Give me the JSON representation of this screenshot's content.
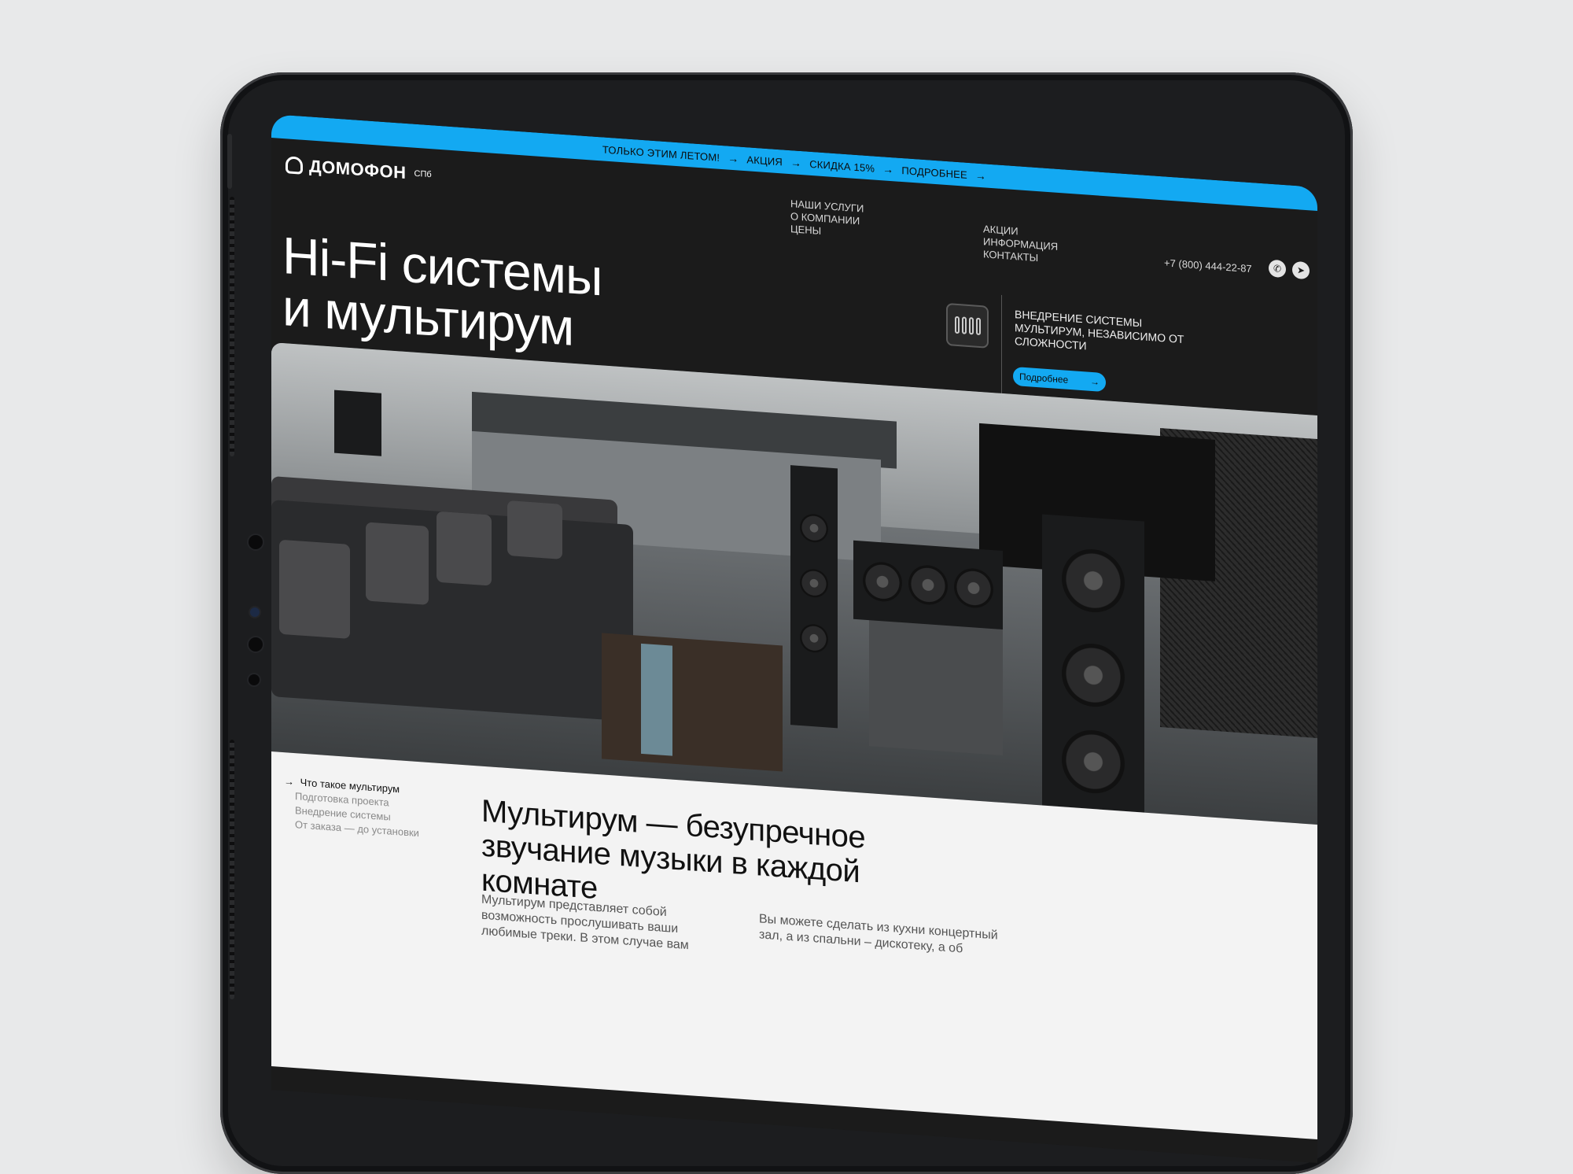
{
  "promo": {
    "text1": "ТОЛЬКО ЭТИМ ЛЕТОМ!",
    "text2": "АКЦИЯ",
    "text3": "СКИДКА 15%",
    "text4": "ПОДРОБНЕЕ",
    "arrow": "→"
  },
  "logo": {
    "name": "ДОМОФОН",
    "suffix": "СПб"
  },
  "nav": {
    "col1": [
      "НАШИ УСЛУГИ",
      "О КОМПАНИИ",
      "ЦЕНЫ"
    ],
    "col2": [
      "АКЦИИ",
      "ИНФОРМАЦИЯ",
      "КОНТАКТЫ"
    ]
  },
  "phone": "+7 (800) 444-22-87",
  "social": {
    "whatsapp": "whatsapp-icon",
    "telegram": "telegram-icon"
  },
  "hero": {
    "title_line1": "Hi-Fi системы",
    "title_line2": "и мультирум",
    "description": "ВНЕДРЕНИЕ СИСТЕМЫ МУЛЬТИРУМ, НЕЗАВИСИМО ОТ СЛОЖНОСТИ",
    "button": "Подробнее",
    "button_arrow": "→"
  },
  "toc": {
    "active": "Что такое мультирум",
    "active_arrow": "→",
    "items": [
      "Подготовка проекта",
      "Внедрение системы",
      "От заказа — до установки"
    ]
  },
  "content": {
    "title": "Мультирум — безупречное звучание музыки в каждой комнате",
    "para1": "Мультирум представляет собой возможность прослушивать ваши любимые треки. В этом случае вам",
    "para2": "Вы можете сделать из кухни концертный зал, а из спальни – дискотеку, а об"
  },
  "colors": {
    "accent": "#13a9f2",
    "dark": "#1b1b1b",
    "light": "#f3f3f3"
  }
}
